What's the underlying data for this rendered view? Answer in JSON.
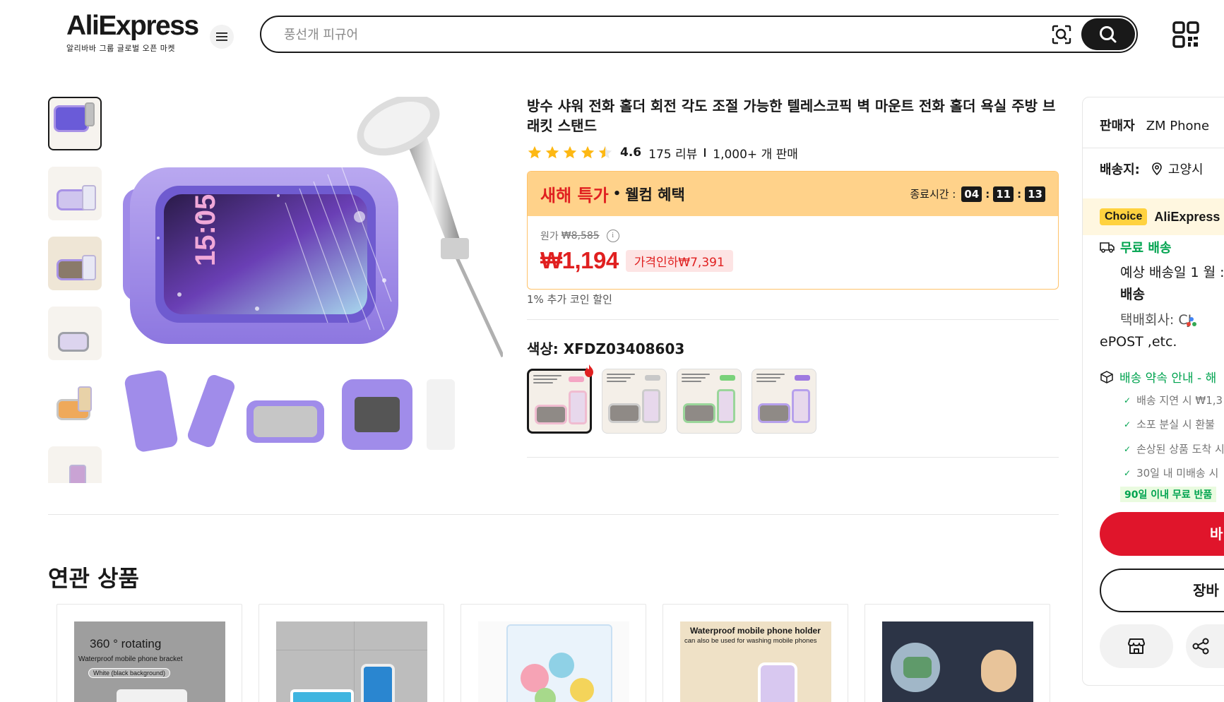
{
  "header": {
    "logo_text": "AliExpress",
    "logo_sub": "알리바바 그룹 글로벌 오픈 마켓",
    "search_placeholder": "풍선개 피규어"
  },
  "gallery": {
    "thumb_count": 6
  },
  "product": {
    "title": "방수 샤워 전화 홀더 회전 각도 조절 가능한 텔레스코픽 벽 마운트 전화 홀더 욕실 주방 브래킷 스탠드",
    "rating": "4.6",
    "reviews": "175 리뷰",
    "sold": "1,000+ 개 판매"
  },
  "deal": {
    "title": "새해 특가",
    "dot": "•",
    "welcome": "웰컴 혜택",
    "timer_label": "종료시간 :",
    "hours": "04",
    "minutes": "11",
    "seconds": "13",
    "original_label": "원가",
    "original_price": "₩8,585",
    "price": "₩1,194",
    "discount": "가격인하₩7,391"
  },
  "coin_note": "1% 추가 코인 할인",
  "color": {
    "label": "색상: XFDZ03408603",
    "swatches": [
      {
        "tag_color": "#f4a6c4"
      },
      {
        "tag_color": "#c8c8c8"
      },
      {
        "tag_color": "#7ad27a"
      },
      {
        "tag_color": "#9f7ae0"
      }
    ]
  },
  "related": {
    "title": "연관 상품",
    "card1_title": "360 ° rotating",
    "card1_sub": "Waterproof mobile phone bracket",
    "card1_pill": "White (black background)",
    "card4_title": "Waterproof mobile phone holder",
    "card4_sub": "can also be used for washing mobile phones"
  },
  "side": {
    "seller_label": "판매자",
    "seller_value": "ZM Phone",
    "ship_to_label": "배송지:",
    "ship_to_value": "고양시",
    "choice_badge": "Choice",
    "choice_name": "AliExpress",
    "free_shipping": "무료 배송",
    "delivery_line1": "예상 배송일 1 월 :",
    "delivery_line2": "배송",
    "carrier_line1": "택배회사:    CJ",
    "carrier_line2": "ePOST ,etc.",
    "promise_title": "배송 약속 안내 - 해",
    "promise_items": [
      "배송 지연 시 ₩1,3",
      "소포 분실 시 환불",
      "손상된 상품 도착 시",
      "30일 내 미배송 시"
    ],
    "free_return": "90일 이내 무료 반품",
    "buy_label": "바",
    "cart_label": "장바"
  },
  "colors": {
    "brand_red": "#e02020",
    "deal_bg": "#ffd28a",
    "green": "#00a34f",
    "purple": "#9f8ae8"
  }
}
